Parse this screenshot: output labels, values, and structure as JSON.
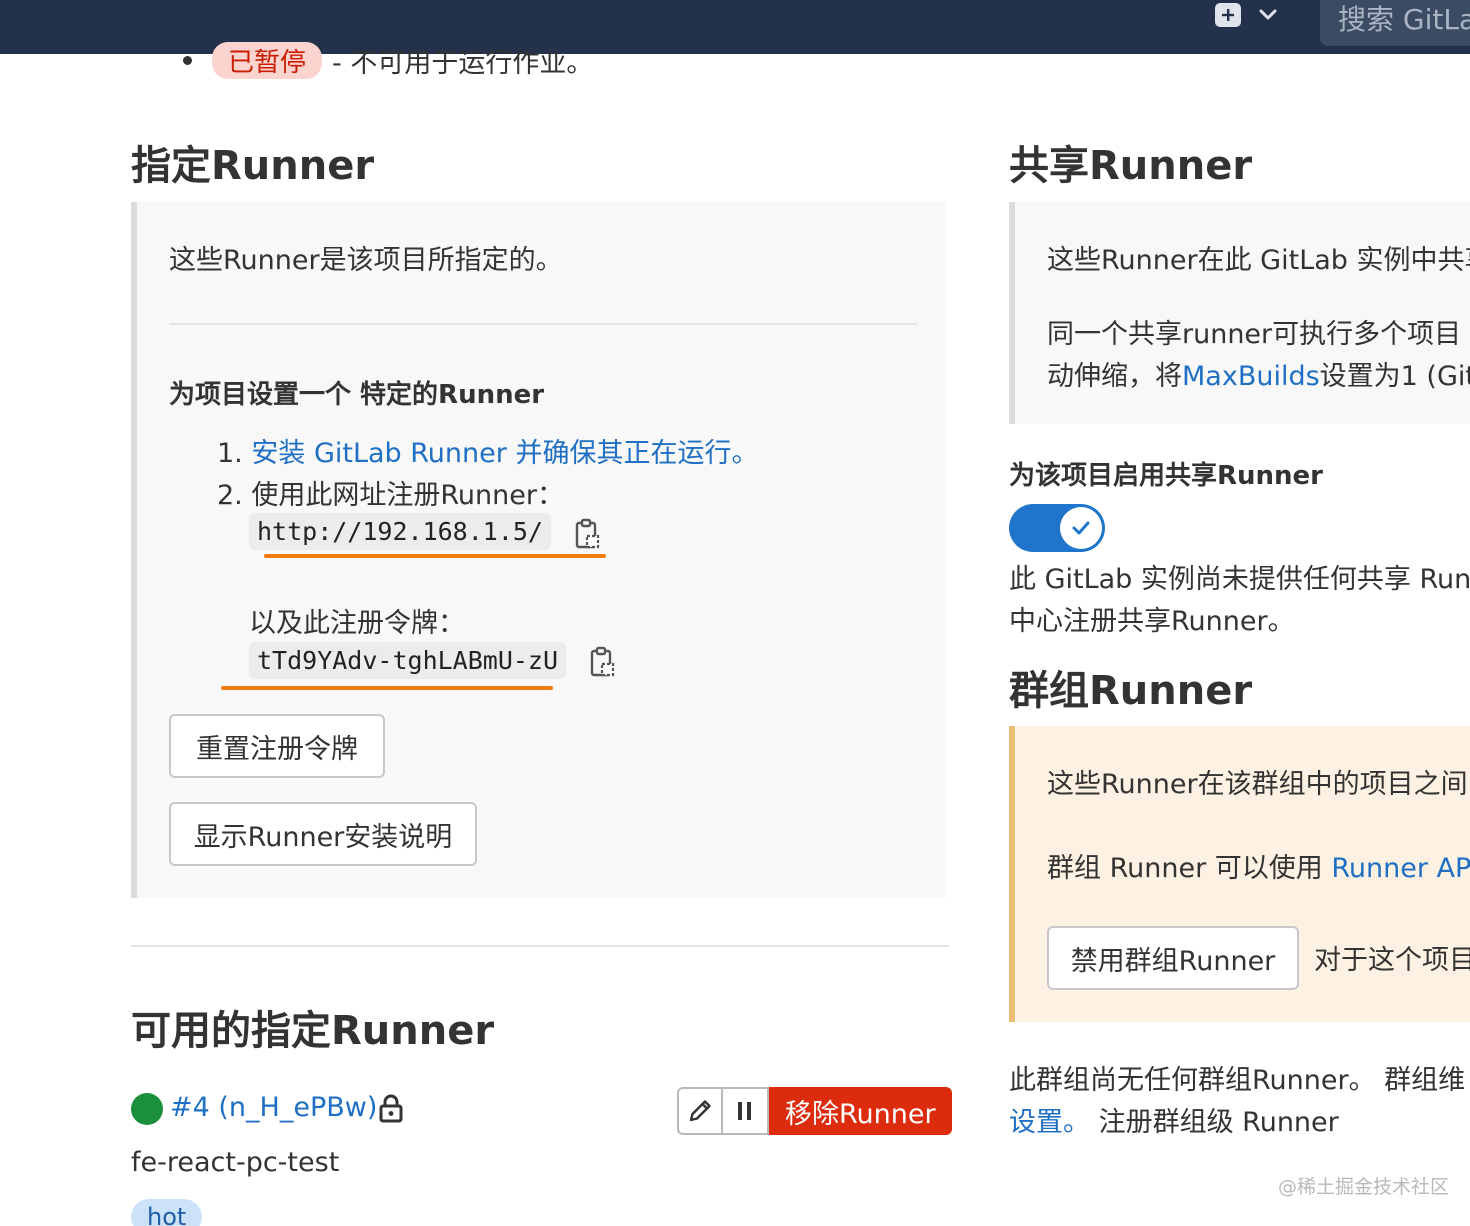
{
  "topbar": {
    "search_placeholder": "搜索 GitLa",
    "plus_icon": "plus-square-icon",
    "chevron_icon": "chevron-down-icon"
  },
  "status_legend": {
    "paused_badge": "已暂停",
    "paused_desc": "- 不可用于运行作业。"
  },
  "specific": {
    "title": "指定Runner",
    "intro": "这些Runner是该项目所指定的。",
    "setup_heading": "为项目设置一个 特定的Runner",
    "step1_num": "1.",
    "step1_link": "安装 GitLab Runner 并确保其正在运行。",
    "step2": "2. 使用此网址注册Runner：",
    "url": "http://192.168.1.5/",
    "token_label": "以及此注册令牌：",
    "token": "tTd9YAdv-tghLABmU-zU",
    "reset_button": "重置注册令牌",
    "show_install_button": "显示Runner安装说明"
  },
  "available": {
    "title": "可用的指定Runner",
    "runner_id": "#4 (n_H_ePBw)",
    "runner_desc": "fe-react-pc-test",
    "tag": "hot",
    "remove_button": "移除Runner",
    "status_color": "#1a8f3c"
  },
  "shared": {
    "title": "共享Runner",
    "line1": "这些Runner在此 GitLab 实例中共享",
    "line2": "同一个共享runner可执行多个项目",
    "line3_pre": "动伸缩，将",
    "line3_link": "MaxBuilds",
    "line3_post": "设置为1 (Git",
    "enable_heading": "为该项目启用共享Runner",
    "toggle_on": true,
    "none_line1": "此 GitLab 实例尚未提供任何共享 Run",
    "none_line2": "中心注册共享Runner。"
  },
  "group": {
    "title": "群组Runner",
    "line1": "这些Runner在该群组中的项目之间",
    "line2_pre": "群组 Runner 可以使用 ",
    "line2_link": "Runner API",
    "disable_button": "禁用群组Runner",
    "disable_note": "对于这个项目",
    "none_line1": "此群组尚无任何群组Runner。 群组维",
    "none_line2_link": "设置。",
    "none_line2_post": " 注册群组级 Runner"
  },
  "watermark": "@稀土掘金技术社区",
  "colors": {
    "topbar": "#23324a",
    "link": "#1f6fc4",
    "danger": "#dd2b0e",
    "toggle": "#1f75cb",
    "highlight_underline": "#f07c12"
  }
}
